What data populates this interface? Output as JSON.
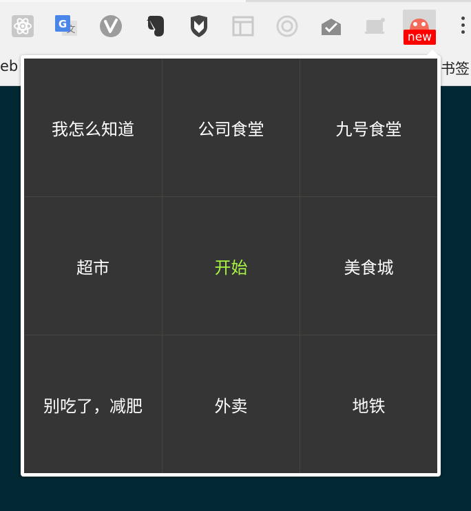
{
  "toolbar": {
    "extensions": [
      {
        "name": "react-devtools-icon"
      },
      {
        "name": "google-translate-icon"
      },
      {
        "name": "vimium-icon"
      },
      {
        "name": "evernote-icon"
      },
      {
        "name": "mcafee-shield-icon"
      },
      {
        "name": "layout-grid-icon"
      },
      {
        "name": "target-ring-icon"
      },
      {
        "name": "inbox-check-icon"
      },
      {
        "name": "screen-capture-icon"
      },
      {
        "name": "food-picker-icon"
      }
    ],
    "badge": "new"
  },
  "bookmarks": {
    "left_partial": "eb",
    "right_label": "书签"
  },
  "popup": {
    "cells": [
      {
        "label": "我怎么知道"
      },
      {
        "label": "公司食堂"
      },
      {
        "label": "九号食堂"
      },
      {
        "label": "超市"
      },
      {
        "label": "开始"
      },
      {
        "label": "美食城"
      },
      {
        "label": "别吃了，减肥"
      },
      {
        "label": "外卖"
      },
      {
        "label": "地铁"
      }
    ],
    "start_color": "#a7f542",
    "cell_bg": "#353535"
  }
}
